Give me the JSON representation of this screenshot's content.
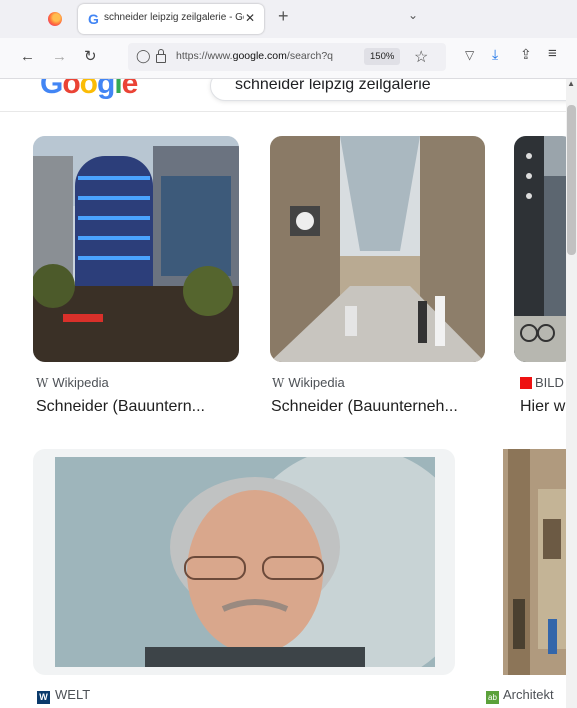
{
  "browser": {
    "tab": {
      "title": "schneider leipzig zeilgalerie - Go",
      "favicon": "G"
    },
    "url": {
      "prefix": "https://www.",
      "domain": "google.com",
      "rest": "/search?q"
    },
    "zoom": "150%"
  },
  "search": {
    "query": "schneider leipzig zeilgalerie"
  },
  "results": [
    {
      "source": "Wikipedia",
      "title": "Schneider (Bauuntern..."
    },
    {
      "source": "Wikipedia",
      "title": "Schneider (Bauunterneh..."
    },
    {
      "source": "BILD",
      "title": "Hier w"
    },
    {
      "source": "WELT",
      "title": ""
    },
    {
      "source": "Architekt",
      "title": ""
    }
  ],
  "colors": {
    "google_blue": "#4285f4",
    "google_red": "#ea4335",
    "google_yellow": "#fbbc05",
    "google_green": "#34a853"
  },
  "icons": [
    "firefox-icon",
    "back-icon",
    "forward-icon",
    "reload-icon",
    "shield-icon",
    "lock-icon",
    "star-icon",
    "pocket-icon",
    "download-icon",
    "extensions-icon",
    "menu-icon"
  ]
}
